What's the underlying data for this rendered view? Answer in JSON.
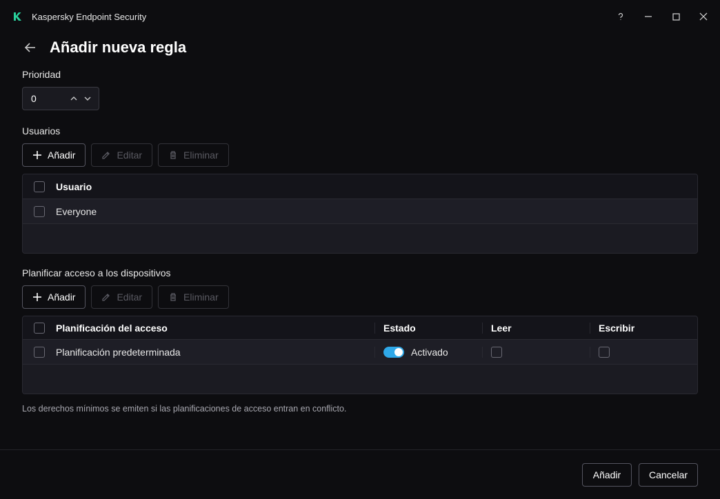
{
  "titlebar": {
    "app_name": "Kaspersky Endpoint Security"
  },
  "page": {
    "title": "Añadir nueva regla"
  },
  "priority": {
    "label": "Prioridad",
    "value": "0"
  },
  "users": {
    "label": "Usuarios",
    "toolbar": {
      "add": "Añadir",
      "edit": "Editar",
      "delete": "Eliminar"
    },
    "columns": {
      "user": "Usuario"
    },
    "rows": [
      {
        "name": "Everyone"
      }
    ]
  },
  "schedule": {
    "label": "Planificar acceso a los dispositivos",
    "toolbar": {
      "add": "Añadir",
      "edit": "Editar",
      "delete": "Eliminar"
    },
    "columns": {
      "plan": "Planificación del acceso",
      "state": "Estado",
      "read": "Leer",
      "write": "Escribir"
    },
    "rows": [
      {
        "name": "Planificación predeterminada",
        "state_label": "Activado"
      }
    ],
    "note": "Los derechos mínimos se emiten si las planificaciones de acceso entran en conflicto."
  },
  "footer": {
    "add": "Añadir",
    "cancel": "Cancelar"
  }
}
